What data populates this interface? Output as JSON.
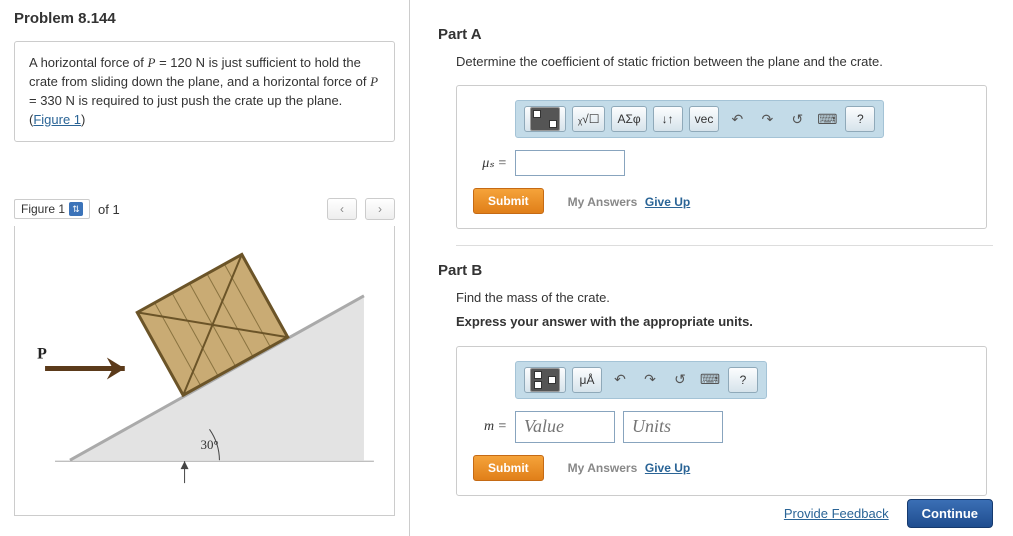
{
  "problem": {
    "title": "Problem 8.144",
    "text_before": "A horizontal force of ",
    "P1_var": "P",
    "P1_val": " = 120 N",
    "text_mid1": " is just sufficient to hold the crate from sliding down the plane, and a horizontal force of ",
    "P2_var": "P",
    "P2_val": " = 330 N",
    "text_mid2": " is required to just push the crate up the plane.(",
    "figure_link": "Figure 1",
    "text_after": ")"
  },
  "figure": {
    "label": "Figure 1",
    "of": "of 1",
    "P_label": "P",
    "angle": "30°"
  },
  "partA": {
    "title": "Part A",
    "prompt": "Determine the coefficient of static friction between the plane and the crate.",
    "var_label": "μₛ =",
    "toolbar": {
      "templates": "",
      "root": "ᵪ√☐",
      "greek": "ΑΣφ",
      "updown": "↓↑",
      "vec": "vec",
      "undo": "↶",
      "redo": "↷",
      "reset": "↺",
      "keyboard": "⌨",
      "help": "?"
    },
    "submit": "Submit",
    "my_answers": "My Answers",
    "giveup": "Give Up"
  },
  "partB": {
    "title": "Part B",
    "prompt": "Find the mass of the crate.",
    "prompt2": "Express your answer with the appropriate units.",
    "var_label": "m =",
    "value_ph": "Value",
    "units_ph": "Units",
    "toolbar": {
      "templates": "",
      "units": "μÅ",
      "undo": "↶",
      "redo": "↷",
      "reset": "↺",
      "keyboard": "⌨",
      "help": "?"
    },
    "submit": "Submit",
    "my_answers": "My Answers",
    "giveup": "Give Up"
  },
  "footer": {
    "feedback": "Provide Feedback",
    "continue": "Continue"
  }
}
